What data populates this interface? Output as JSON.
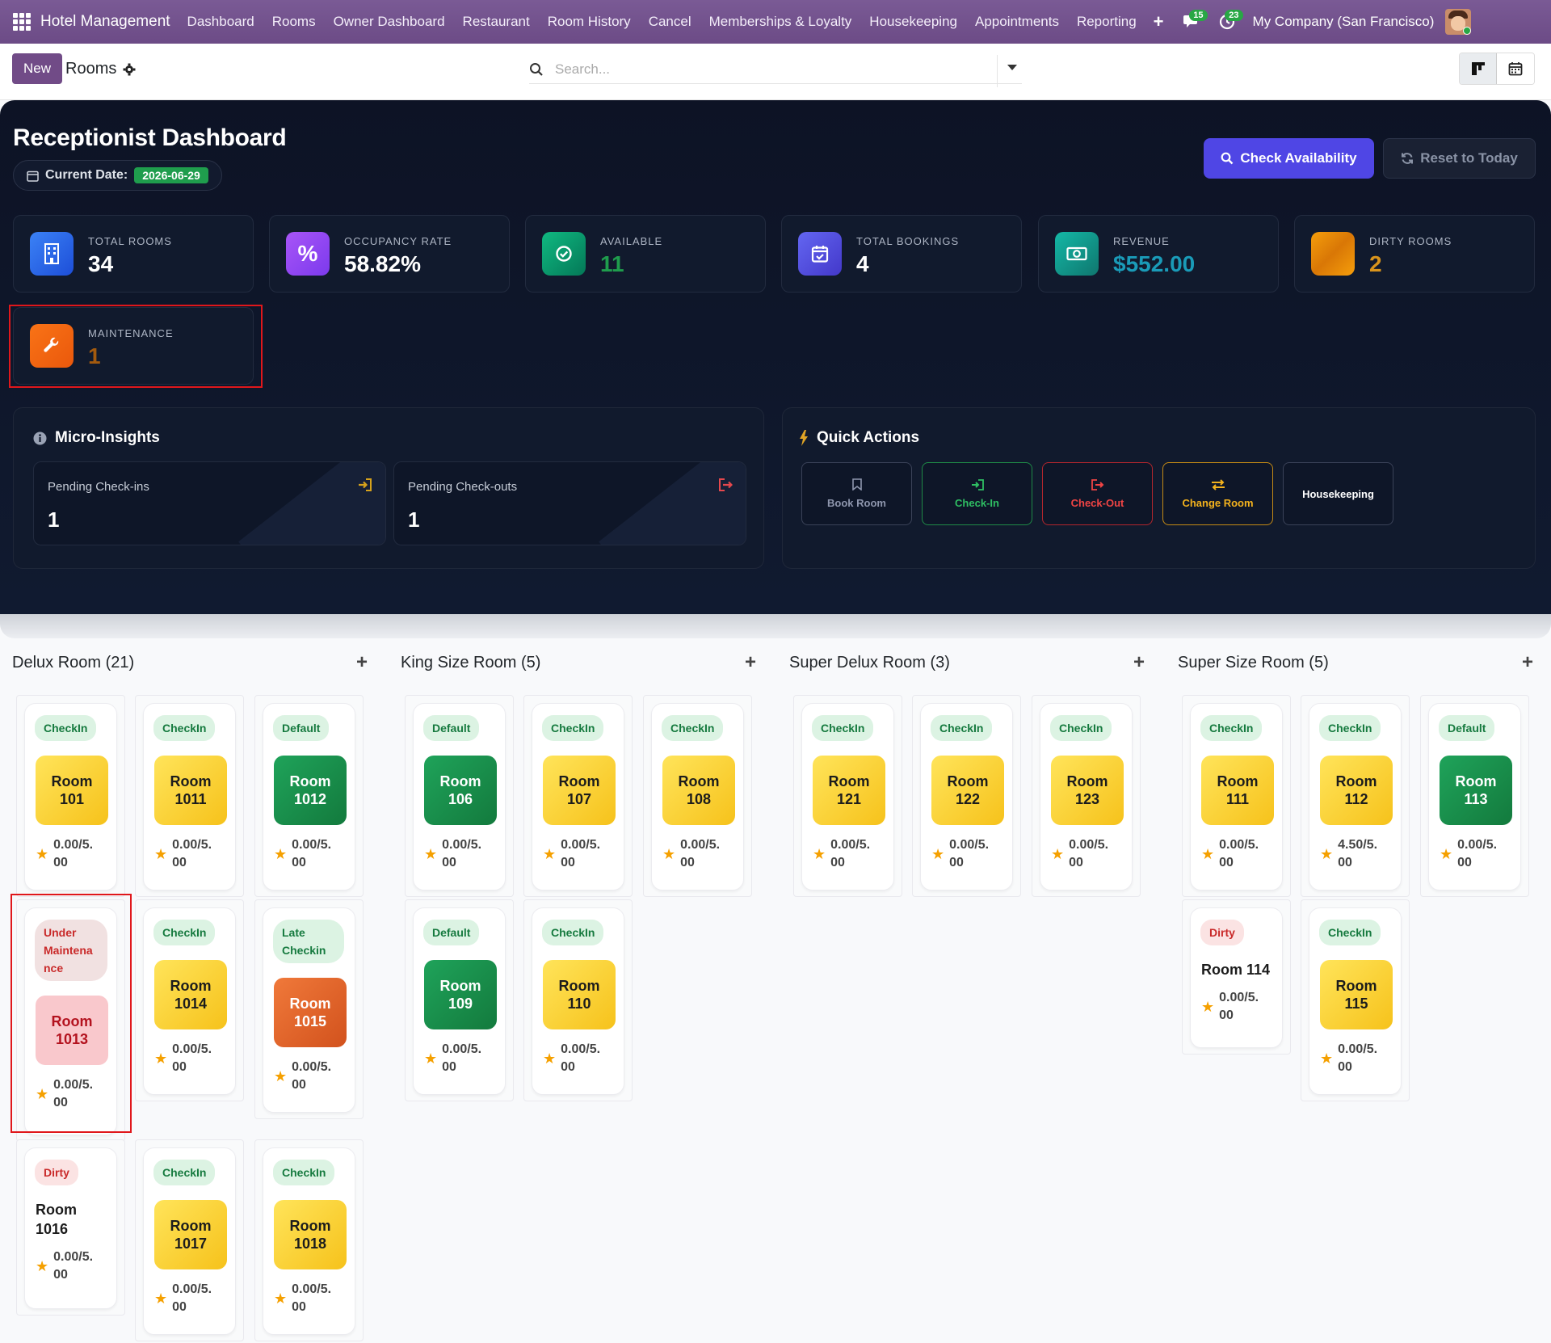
{
  "navbar": {
    "brand": "Hotel Management",
    "menu": [
      "Dashboard",
      "Rooms",
      "Owner Dashboard",
      "Restaurant",
      "Room History",
      "Cancel",
      "Memberships & Loyalty",
      "Housekeeping",
      "Appointments",
      "Reporting"
    ],
    "plus": "+",
    "messages_count": "15",
    "activities_count": "23",
    "company": "My Company (San Francisco)"
  },
  "control_panel": {
    "new_label": "New",
    "title": "Rooms",
    "search_placeholder": "Search..."
  },
  "dashboard": {
    "title": "Receptionist Dashboard",
    "current_date_label": "Current Date:",
    "current_date": "2026-06-29",
    "check_availability": "Check Availability",
    "reset_to_today": "Reset to Today",
    "stats": [
      {
        "label": "TOTAL ROOMS",
        "value": "34",
        "color": "#ffffff"
      },
      {
        "label": "OCCUPANCY RATE",
        "value": "58.82%",
        "color": "#ffffff"
      },
      {
        "label": "AVAILABLE",
        "value": "11",
        "color": "#1f9d4d"
      },
      {
        "label": "TOTAL BOOKINGS",
        "value": "4",
        "color": "#ffffff"
      },
      {
        "label": "REVENUE",
        "value": "$552.00",
        "color": "#1a9bb8"
      },
      {
        "label": "DIRTY ROOMS",
        "value": "2",
        "color": "#d9941c"
      },
      {
        "label": "MAINTENANCE",
        "value": "1",
        "color": "#a35a0e"
      }
    ],
    "micro_insights": {
      "title": "Micro-Insights",
      "pending_checkins_label": "Pending Check-ins",
      "pending_checkins": "1",
      "pending_checkouts_label": "Pending Check-outs",
      "pending_checkouts": "1"
    },
    "quick_actions": {
      "title": "Quick Actions",
      "book_room": "Book Room",
      "check_in": "Check-In",
      "check_out": "Check-Out",
      "change_room": "Change Room",
      "housekeeping": "Housekeeping"
    }
  },
  "kanban": {
    "columns": [
      {
        "title": "Delux Room (21)",
        "plus": "+"
      },
      {
        "title": "King Size Room (5)",
        "plus": "+"
      },
      {
        "title": "Super Delux Room (3)",
        "plus": "+"
      },
      {
        "title": "Super Size Room (5)",
        "plus": "+"
      }
    ],
    "cards": [
      {
        "status": "CheckIn",
        "room": [
          "Room",
          "101"
        ],
        "rating": [
          "0.00/5.",
          "00"
        ]
      },
      {
        "status": "CheckIn",
        "room": [
          "Room",
          "1011"
        ],
        "rating": [
          "0.00/5.",
          "00"
        ]
      },
      {
        "status": "Default",
        "room": [
          "Room",
          "1012"
        ],
        "rating": [
          "0.00/5.",
          "00"
        ]
      },
      {
        "status": "Under Maintenance",
        "status_lines": [
          "Under",
          "Maintena",
          "nce"
        ],
        "room": [
          "Room",
          "1013"
        ],
        "rating": [
          "0.00/5.",
          "00"
        ]
      },
      {
        "status": "CheckIn",
        "room": [
          "Room",
          "1014"
        ],
        "rating": [
          "0.00/5.",
          "00"
        ]
      },
      {
        "status": "Late Checkin",
        "status_lines": [
          "Late",
          "Checkin"
        ],
        "room": [
          "Room",
          "1015"
        ],
        "rating": [
          "0.00/5.",
          "00"
        ]
      },
      {
        "status": "Dirty",
        "room": [
          "Room",
          "1016"
        ],
        "rating": [
          "0.00/5.",
          "00"
        ]
      },
      {
        "status": "CheckIn",
        "room": [
          "Room",
          "1017"
        ],
        "rating": [
          "0.00/5.",
          "00"
        ]
      },
      {
        "status": "CheckIn",
        "room": [
          "Room",
          "1018"
        ],
        "rating": [
          "0.00/5.",
          "00"
        ]
      },
      {
        "status": "Default",
        "room": [
          "Room",
          "106"
        ],
        "rating": [
          "0.00/5.",
          "00"
        ]
      },
      {
        "status": "CheckIn",
        "room": [
          "Room",
          "107"
        ],
        "rating": [
          "0.00/5.",
          "00"
        ]
      },
      {
        "status": "CheckIn",
        "room": [
          "Room",
          "108"
        ],
        "rating": [
          "0.00/5.",
          "00"
        ]
      },
      {
        "status": "Default",
        "room": [
          "Room",
          "109"
        ],
        "rating": [
          "0.00/5.",
          "00"
        ]
      },
      {
        "status": "CheckIn",
        "room": [
          "Room",
          "110"
        ],
        "rating": [
          "0.00/5.",
          "00"
        ]
      },
      {
        "status": "CheckIn",
        "room": [
          "Room",
          "121"
        ],
        "rating": [
          "0.00/5.",
          "00"
        ]
      },
      {
        "status": "CheckIn",
        "room": [
          "Room",
          "122"
        ],
        "rating": [
          "0.00/5.",
          "00"
        ]
      },
      {
        "status": "CheckIn",
        "room": [
          "Room",
          "123"
        ],
        "rating": [
          "0.00/5.",
          "00"
        ]
      },
      {
        "status": "CheckIn",
        "room": [
          "Room",
          "111"
        ],
        "rating": [
          "0.00/5.",
          "00"
        ]
      },
      {
        "status": "CheckIn",
        "room": [
          "Room",
          "112"
        ],
        "rating": [
          "4.50/5.",
          "00"
        ]
      },
      {
        "status": "Default",
        "room": [
          "Room",
          "113"
        ],
        "rating": [
          "0.00/5.",
          "00"
        ]
      },
      {
        "status": "Dirty",
        "room": [
          "Room 114"
        ],
        "rating": [
          "0.00/5.",
          "00"
        ]
      },
      {
        "status": "CheckIn",
        "room": [
          "Room",
          "115"
        ],
        "rating": [
          "0.00/5.",
          "00"
        ]
      }
    ]
  }
}
